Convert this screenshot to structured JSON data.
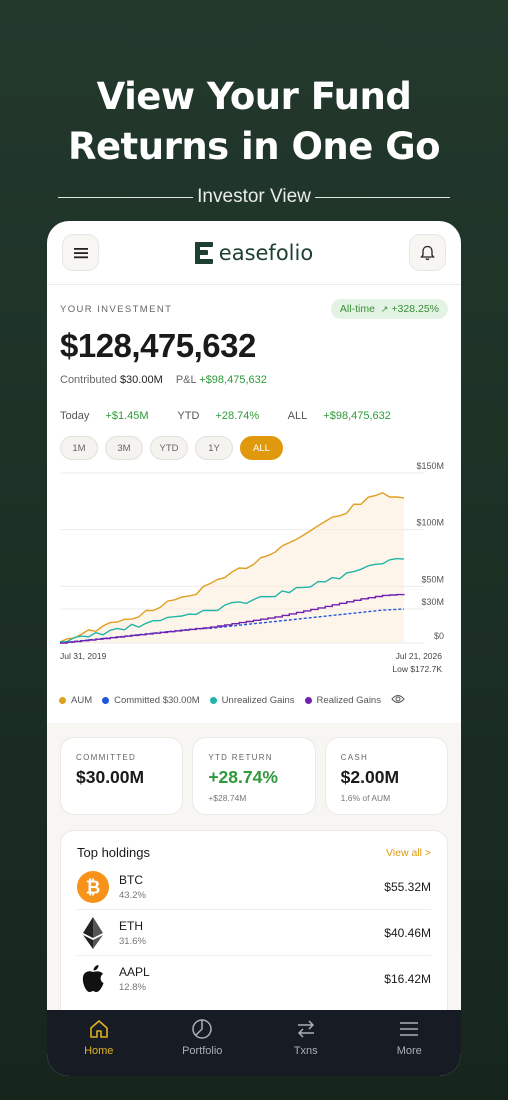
{
  "headline": {
    "line1": "View Your Fund",
    "line2": "Returns in One Go"
  },
  "subtitle": "Investor View",
  "app": {
    "brand": "easefolio",
    "menu_icon": "hamburger-icon",
    "notification_icon": "bell-icon"
  },
  "investment": {
    "label": "YOUR INVESTMENT",
    "alltime_label": "All-time",
    "alltime_value": "+328.25%",
    "total": "$128,475,632",
    "contributed_label": "Contributed",
    "contributed_value": "$30.00M",
    "pnl_label": "P&L",
    "pnl_value": "+$98,475,632",
    "today_label": "Today",
    "today_value": "+$1.45M",
    "ytd_label": "YTD",
    "ytd_value": "+28.74%",
    "all_label": "ALL",
    "all_value": "+$98,475,632"
  },
  "ranges": [
    {
      "label": "1M",
      "active": false
    },
    {
      "label": "3M",
      "active": false
    },
    {
      "label": "YTD",
      "active": false
    },
    {
      "label": "1Y",
      "active": false
    },
    {
      "label": "ALL",
      "active": true
    }
  ],
  "chart_data": {
    "type": "line",
    "y_ticks": [
      "$150M",
      "$100M",
      "$50M",
      "$30M",
      "$0"
    ],
    "x_start": "Jul 31, 2019",
    "x_end": "Jul 21, 2026",
    "low_label": "Low $172.7K",
    "ylim": [
      0,
      150
    ],
    "series": [
      {
        "name": "AUM",
        "color": "#e0a020",
        "values": [
          2,
          8,
          14,
          20,
          27,
          35,
          42,
          51,
          61,
          71,
          82,
          92,
          103,
          113,
          124,
          132,
          128
        ]
      },
      {
        "name": "Committed $30.00M",
        "color": "#2255dd",
        "values": [
          0,
          2,
          4,
          6,
          8,
          10,
          12,
          13,
          15,
          17,
          19,
          21,
          23,
          25,
          27,
          29,
          30
        ]
      },
      {
        "name": "Unrealized Gains",
        "color": "#20b5a8",
        "values": [
          1,
          5,
          9,
          13,
          17,
          21,
          25,
          29,
          34,
          38,
          43,
          47,
          53,
          58,
          64,
          72,
          74
        ]
      },
      {
        "name": "Realized Gains",
        "color": "#7020b0",
        "values": [
          0,
          2,
          4,
          6,
          8,
          10,
          12,
          14,
          17,
          20,
          23,
          27,
          31,
          35,
          39,
          42,
          43
        ]
      }
    ],
    "legend": [
      {
        "label": "AUM",
        "color": "#e0a020"
      },
      {
        "label": "Committed $30.00M",
        "color": "#2255dd"
      },
      {
        "label": "Unrealized Gains",
        "color": "#20b5a8"
      },
      {
        "label": "Realized Gains",
        "color": "#7020b0"
      }
    ]
  },
  "metrics": [
    {
      "label": "COMMITTED",
      "value": "$30.00M",
      "sub": "",
      "color": "#1a1a1a"
    },
    {
      "label": "YTD RETURN",
      "value": "+28.74%",
      "sub": "+$28.74M",
      "color": "#2e9a3a"
    },
    {
      "label": "CASH",
      "value": "$2.00M",
      "sub": "1.6% of AUM",
      "color": "#1a1a1a"
    }
  ],
  "holdings": {
    "title": "Top holdings",
    "view_all": "View all >",
    "items": [
      {
        "name": "BTC",
        "pct": "43.2%",
        "value": "$55.32M",
        "icon": "bitcoin-icon"
      },
      {
        "name": "ETH",
        "pct": "31.6%",
        "value": "$40.46M",
        "icon": "ethereum-icon"
      },
      {
        "name": "AAPL",
        "pct": "12.8%",
        "value": "$16.42M",
        "icon": "apple-icon"
      }
    ]
  },
  "nav": [
    {
      "label": "Home",
      "icon": "home-icon",
      "active": true
    },
    {
      "label": "Portfolio",
      "icon": "pie-chart-icon",
      "active": false
    },
    {
      "label": "Txns",
      "icon": "swap-arrows-icon",
      "active": false
    },
    {
      "label": "More",
      "icon": "menu-icon",
      "active": false
    }
  ],
  "colors": {
    "accent": "#e0990d",
    "positive": "#2e9a3a",
    "nav_bg": "#171c24"
  }
}
